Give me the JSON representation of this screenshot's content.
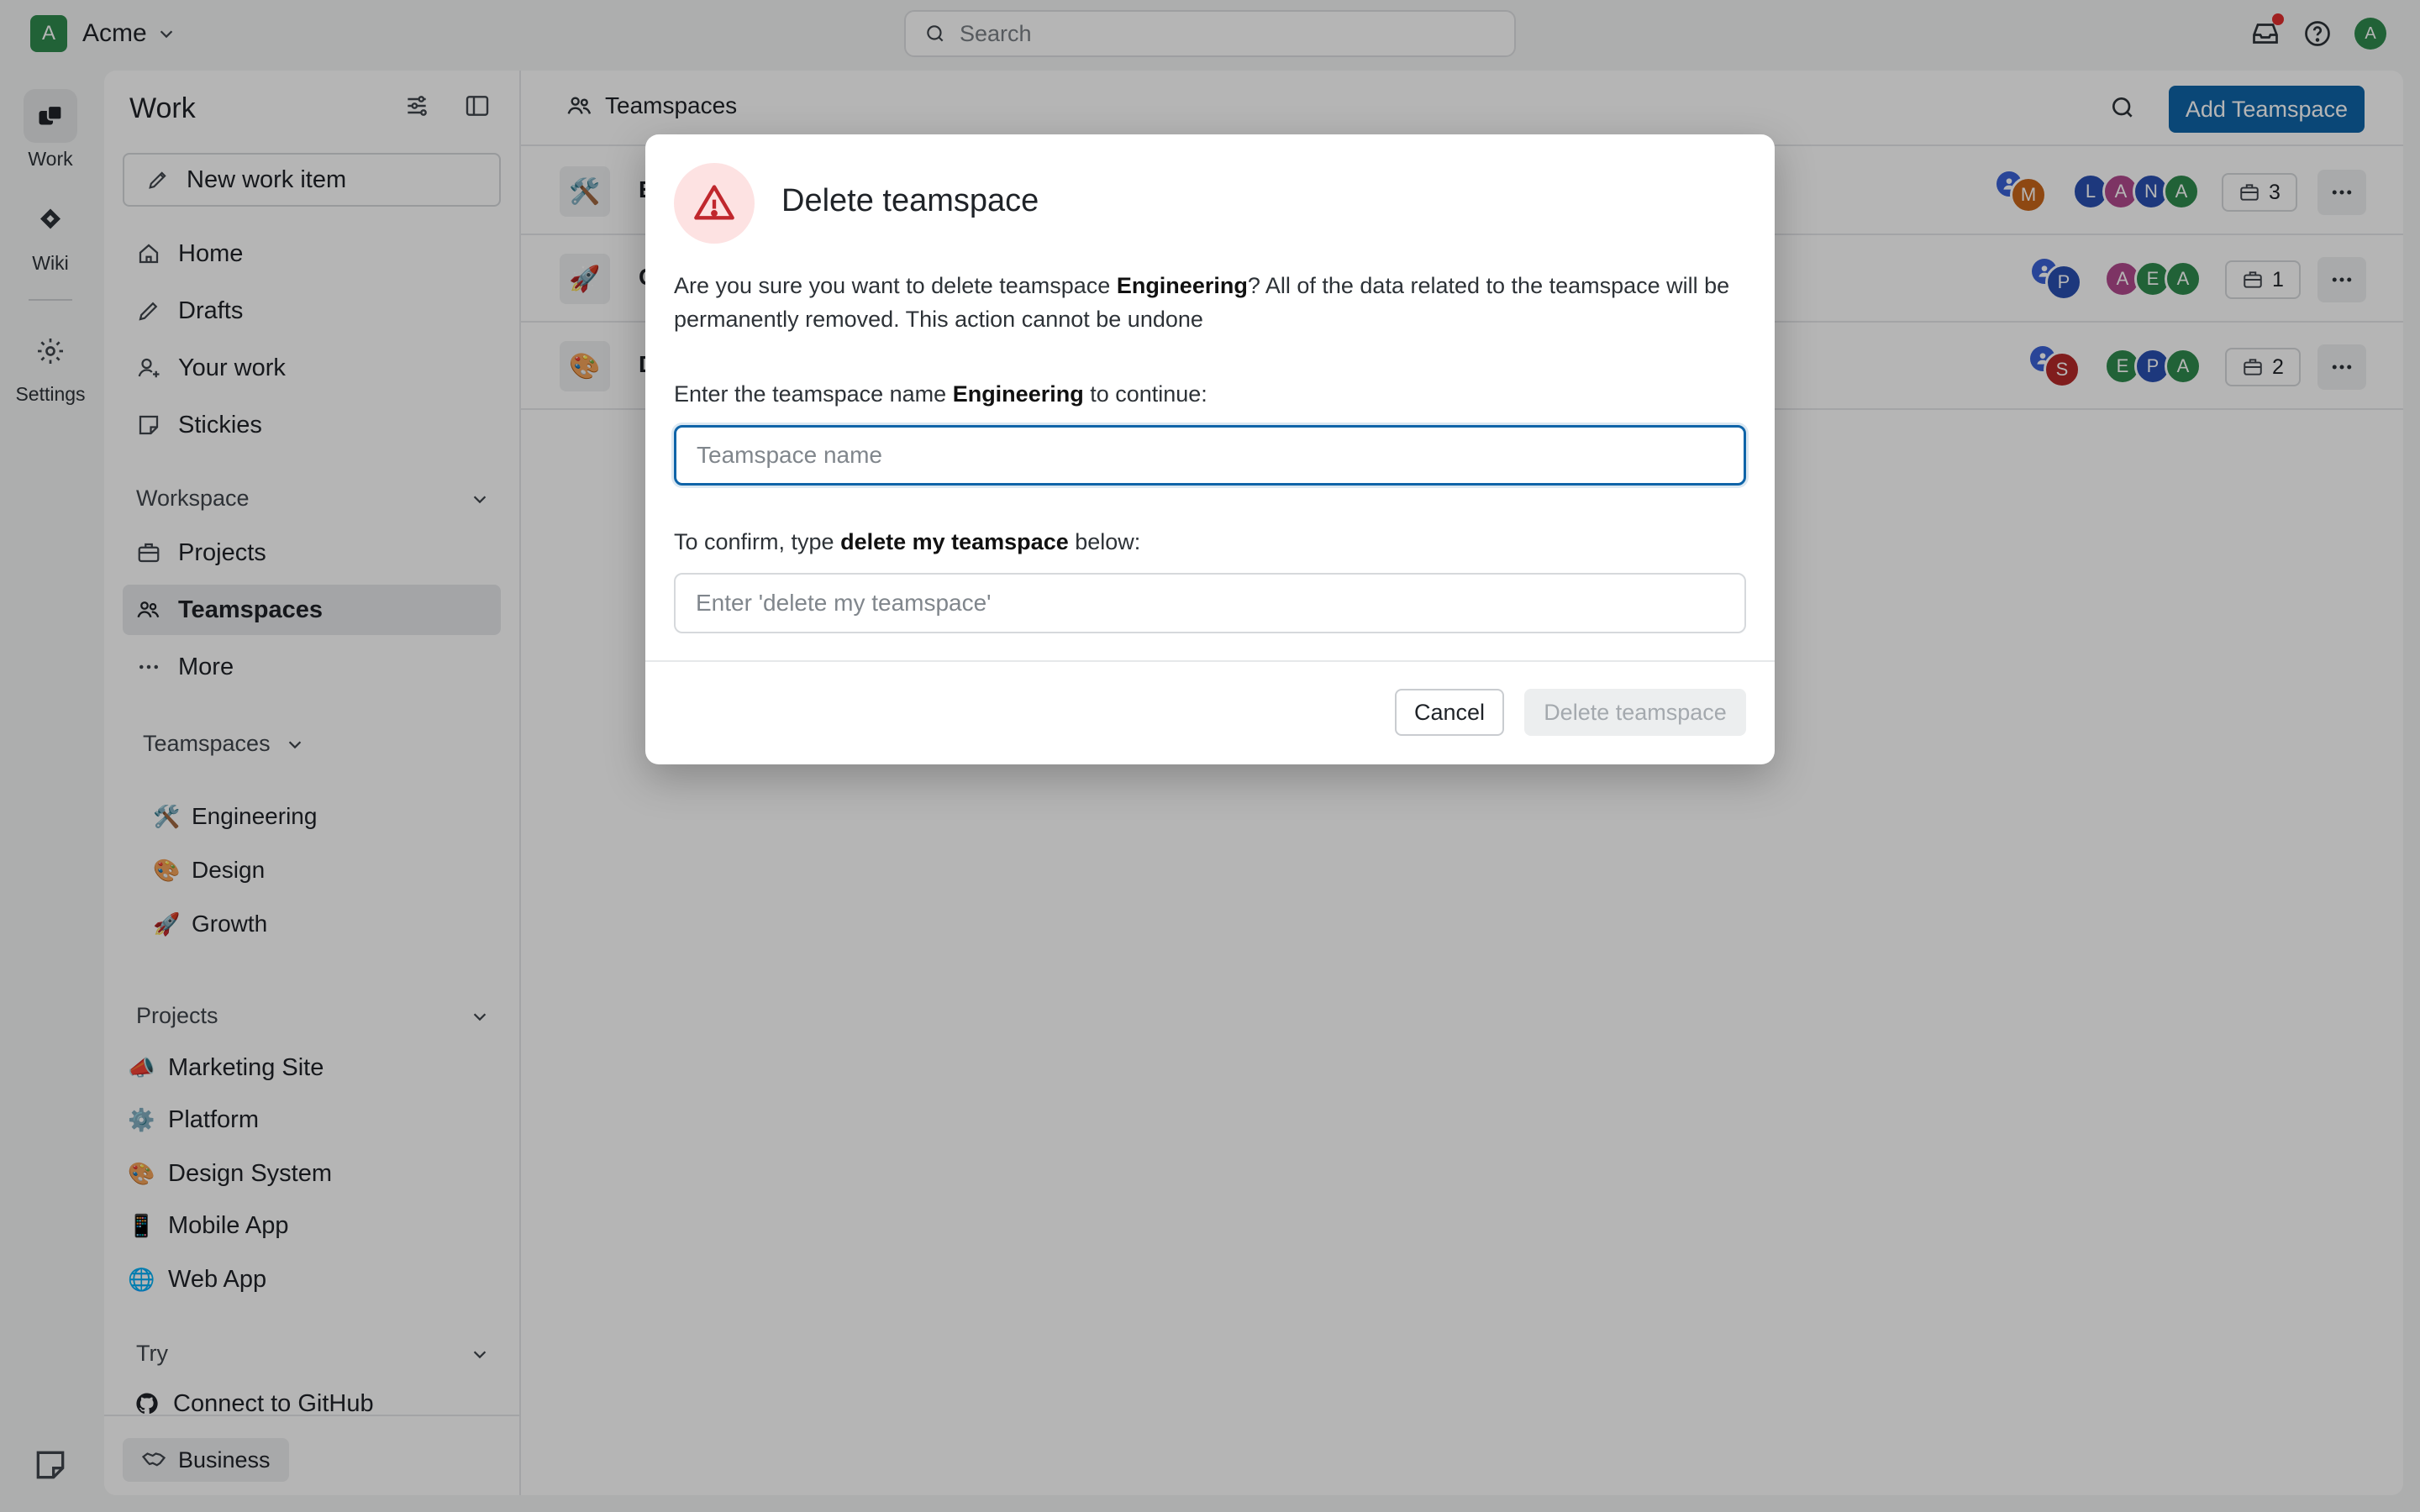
{
  "topbar": {
    "workspace_initial": "A",
    "workspace_name": "Acme",
    "search_placeholder": "Search",
    "user_initial": "A"
  },
  "rail": {
    "items": [
      {
        "label": "Work",
        "icon": "work-icon"
      },
      {
        "label": "Wiki",
        "icon": "wiki-icon"
      },
      {
        "label": "Settings",
        "icon": "gear-icon"
      }
    ]
  },
  "sidebar": {
    "title": "Work",
    "new_item": "New work item",
    "nav": [
      {
        "label": "Home",
        "icon": "home-icon"
      },
      {
        "label": "Drafts",
        "icon": "pencil-icon"
      },
      {
        "label": "Your work",
        "icon": "user-icon"
      },
      {
        "label": "Stickies",
        "icon": "sticky-icon"
      }
    ],
    "workspace_section": "Workspace",
    "workspace_nav": [
      {
        "label": "Projects",
        "icon": "briefcase-icon"
      },
      {
        "label": "Teamspaces",
        "icon": "teamspace-icon"
      },
      {
        "label": "More",
        "icon": "ellipsis-icon"
      }
    ],
    "teamspaces_section": "Teamspaces",
    "teamspaces": [
      {
        "emoji": "🛠️",
        "label": "Engineering"
      },
      {
        "emoji": "🎨",
        "label": "Design"
      },
      {
        "emoji": "🚀",
        "label": "Growth"
      }
    ],
    "projects_section": "Projects",
    "projects": [
      {
        "emoji": "📣",
        "label": "Marketing Site"
      },
      {
        "emoji": "⚙️",
        "label": "Platform"
      },
      {
        "emoji": "🎨",
        "label": "Design System"
      },
      {
        "emoji": "📱",
        "label": "Mobile App"
      },
      {
        "emoji": "🌐",
        "label": "Web App"
      }
    ],
    "try_section": "Try",
    "try_items": [
      {
        "label": "Connect to GitHub",
        "icon": "github-icon"
      }
    ],
    "plan_badge": "Business"
  },
  "main": {
    "title": "Teamspaces",
    "add_button": "Add Teamspace",
    "rows": [
      {
        "emoji": "🛠️",
        "name": "E",
        "lead": "M",
        "members": [
          "L",
          "A",
          "N",
          "A"
        ],
        "project_count": "3"
      },
      {
        "emoji": "🚀",
        "name": "G",
        "lead": "P",
        "members": [
          "A",
          "E",
          "A"
        ],
        "project_count": "1"
      },
      {
        "emoji": "🎨",
        "name": "D",
        "lead": "S",
        "members": [
          "E",
          "P",
          "A"
        ],
        "project_count": "2"
      }
    ]
  },
  "modal": {
    "title": "Delete teamspace",
    "desc_pre": "Are you sure you want to delete teamspace ",
    "desc_name": "Engineering",
    "desc_post": "? All of the data related to the teamspace will be permanently removed. This action cannot be undone",
    "name_label_pre": "Enter the teamspace name ",
    "name_label_name": "Engineering",
    "name_label_post": " to continue:",
    "name_placeholder": "Teamspace name",
    "confirm_label_pre": "To confirm, type ",
    "confirm_label_phrase": "delete my teamspace",
    "confirm_label_post": " below:",
    "confirm_placeholder": "Enter 'delete my teamspace'",
    "cancel": "Cancel",
    "delete": "Delete teamspace"
  },
  "colors": {
    "accent": "#0f64a8",
    "warning_bg": "#fde2e2",
    "warning_icon": "#c0272d",
    "workspace_logo": "#2f8a4e"
  }
}
